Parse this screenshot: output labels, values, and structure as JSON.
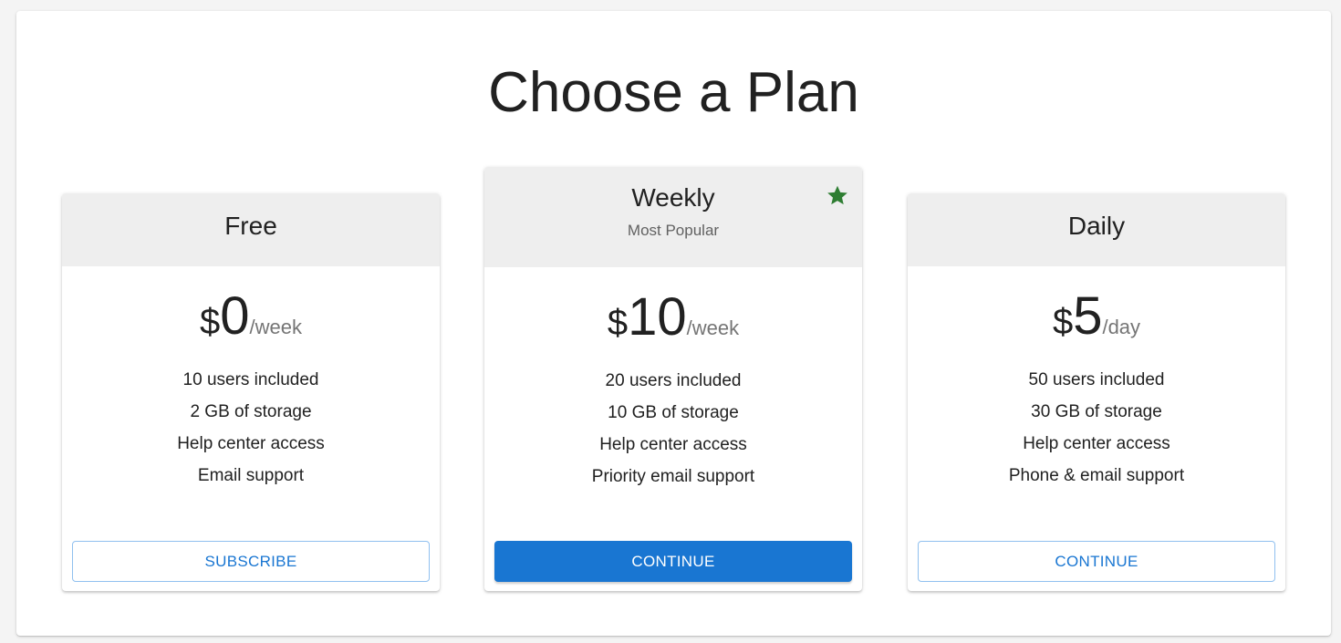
{
  "page": {
    "title": "Choose a Plan"
  },
  "colors": {
    "accent": "#1976d2",
    "header_bg": "#eeeeee",
    "star": "#2e7d32"
  },
  "plans": [
    {
      "name": "Free",
      "subtitle": "",
      "currency": "$",
      "amount": "0",
      "period": "/week",
      "features": [
        "10 users included",
        "2 GB of storage",
        "Help center access",
        "Email support"
      ],
      "button_label": "Subscribe",
      "button_variant": "outlined",
      "featured": false
    },
    {
      "name": "Weekly",
      "subtitle": "Most Popular",
      "icon": "star-icon",
      "currency": "$",
      "amount": "10",
      "period": "/week",
      "features": [
        "20 users included",
        "10 GB of storage",
        "Help center access",
        "Priority email support"
      ],
      "button_label": "Continue",
      "button_variant": "contained",
      "featured": true
    },
    {
      "name": "Daily",
      "subtitle": "",
      "currency": "$",
      "amount": "5",
      "period": "/day",
      "features": [
        "50 users included",
        "30 GB of storage",
        "Help center access",
        "Phone & email support"
      ],
      "button_label": "Continue",
      "button_variant": "outlined",
      "featured": false
    }
  ]
}
